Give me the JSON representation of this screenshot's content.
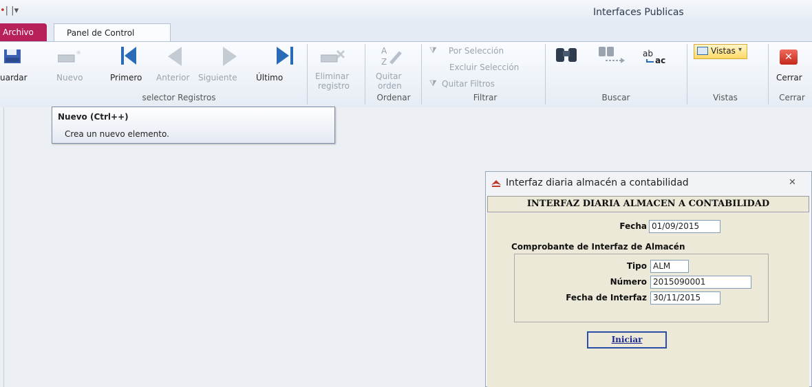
{
  "quick_access": "| |▾",
  "app_title": "Interfaces Publicas",
  "tabs": {
    "archivo": "Archivo",
    "panel": "Panel de Control"
  },
  "ribbon": {
    "guardar": "uardar",
    "nuevo": "Nuevo",
    "primero": "Primero",
    "anterior": "Anterior",
    "siguiente": "Siguiente",
    "ultimo": "Último",
    "eliminar_1": "Eliminar",
    "eliminar_2": "registro",
    "quitar_1": "Quitar",
    "quitar_2": "orden",
    "por_seleccion": "Por Selección",
    "excluir_seleccion": "Excluir Selección",
    "quitar_filtros": "Quitar Filtros",
    "vistas_btn": "Vistas",
    "cerrar": "Cerrar",
    "groups": {
      "selector": "selector Registros",
      "ordenar": "Ordenar",
      "filtrar": "Filtrar",
      "buscar": "Buscar",
      "vistas": "Vistas",
      "cerrar": "Cerrar"
    }
  },
  "tooltip": {
    "title": "Nuevo (Ctrl++)",
    "description": "Crea un nuevo elemento."
  },
  "dialog": {
    "title": "Interfaz diaria almacén a contabilidad",
    "header": "INTERFAZ DIARIA ALMACEN A CONTABILIDAD",
    "fecha_label": "Fecha",
    "fecha_value": "01/09/2015",
    "group_title": "Comprobante de Interfaz de Almacén",
    "tipo_label": "Tipo",
    "tipo_value": "ALM",
    "numero_label": "Número",
    "numero_value": "2015090001",
    "fecha_interfaz_label": "Fecha de Interfaz",
    "fecha_interfaz_value": "30/11/2015",
    "iniciar": "Iniciar"
  },
  "colors": {
    "archivo_tab": "#b8205a",
    "accent_blue": "#2a6bb8",
    "dialog_bg": "#ece9d8"
  }
}
